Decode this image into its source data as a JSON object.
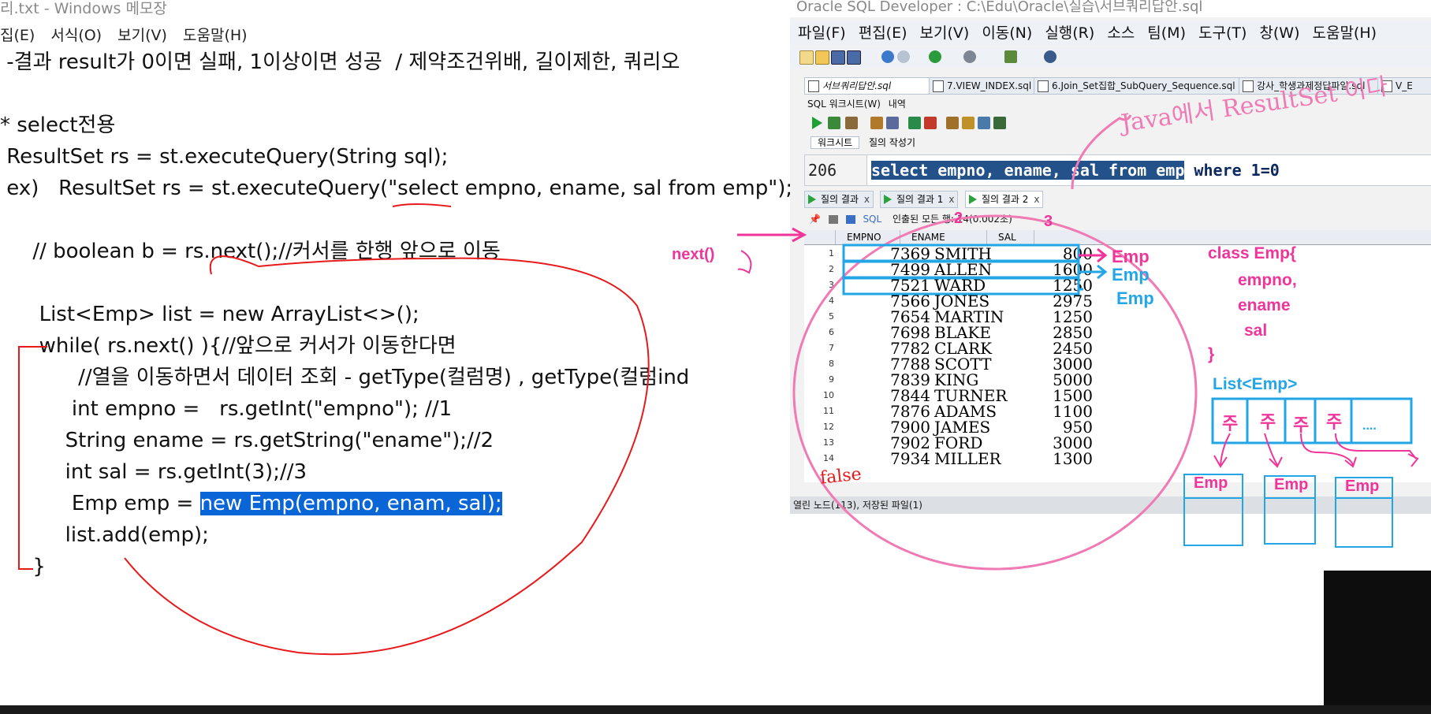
{
  "notepad": {
    "title": "리.txt - Windows 메모장",
    "menu": [
      "집(E)",
      "서식(O)",
      "보기(V)",
      "도움말(H)"
    ],
    "lines": [
      " -결과 result가 0이면 실패, 1이상이면 성공  / 제약조건위배, 길이제한, 쿼리오",
      "",
      "* select전용",
      " ResultSet rs = st.executeQuery(String sql);",
      " ex)   ResultSet rs = st.executeQuery(\"select empno, ename, sal from emp\");",
      "",
      "     // boolean b = rs.next();//커서를 한행 앞으로 이동",
      "",
      "      List<Emp> list = new ArrayList<>();",
      "      while( rs.next() ){//앞으로 커서가 이동한다면",
      "            //열을 이동하면서 데이터 조회 - getType(컬럼명) , getType(컬럼ind",
      "           int empno =   rs.getInt(\"empno\"); //1",
      "          String ename = rs.getString(\"ename\");//2",
      "          int sal = rs.getInt(3);//3",
      "           Emp emp = ",
      "          list.add(emp);",
      "     }"
    ],
    "selected_text": "new Emp(empno, enam, sal);"
  },
  "sqldev": {
    "title": "Oracle SQL Developer : C:\\Edu\\Oracle\\실습\\서브쿼리답안.sql",
    "menu": [
      "파일(F)",
      "편집(E)",
      "보기(V)",
      "이동(N)",
      "실행(R)",
      "소스",
      "팀(M)",
      "도구(T)",
      "창(W)",
      "도움말(H)"
    ],
    "tabs": [
      "서브쿼리답안.sql",
      "7.VIEW_INDEX.sql",
      "6.Join_Set집합_SubQuery_Sequence.sql",
      "강사_학생과제정답파일.sql",
      "V_E"
    ],
    "worksheet_label": "SQL 워크시트(W)",
    "history_label": "내역",
    "ws_tab": "워크시트",
    "query_builder": "질의 작성기",
    "line_no": "206",
    "code_selected": "select empno, ename, sal from emp",
    "code_rest": " where 1=0",
    "result_tabs": [
      "질의 결과",
      "질의 결과 1",
      "질의 결과 2"
    ],
    "result_bar": {
      "sql": "SQL",
      "fetched": "인출된 모든 행: 14(0.002초)"
    },
    "columns": [
      "EMPNO",
      "ENAME",
      "SAL"
    ],
    "rows": [
      [
        "1",
        "7369",
        "SMITH",
        "800"
      ],
      [
        "2",
        "7499",
        "ALLEN",
        "1600"
      ],
      [
        "3",
        "7521",
        "WARD",
        "1250"
      ],
      [
        "4",
        "7566",
        "JONES",
        "2975"
      ],
      [
        "5",
        "7654",
        "MARTIN",
        "1250"
      ],
      [
        "6",
        "7698",
        "BLAKE",
        "2850"
      ],
      [
        "7",
        "7782",
        "CLARK",
        "2450"
      ],
      [
        "8",
        "7788",
        "SCOTT",
        "3000"
      ],
      [
        "9",
        "7839",
        "KING",
        "5000"
      ],
      [
        "10",
        "7844",
        "TURNER",
        "1500"
      ],
      [
        "11",
        "7876",
        "ADAMS",
        "1100"
      ],
      [
        "12",
        "7900",
        "JAMES",
        "950"
      ],
      [
        "13",
        "7902",
        "FORD",
        "3000"
      ],
      [
        "14",
        "7934",
        "MILLER",
        "1300"
      ]
    ],
    "status": "열린 노드(113), 저장된 파일(1)"
  },
  "annotations": {
    "java_resultset": "Java에서 ResultSet 이다",
    "next": "next()",
    "col_num_2": "2",
    "col_num_3": "3",
    "emp_labels": [
      "Emp",
      "Emp",
      "Emp"
    ],
    "class_def": [
      "class Emp{",
      "empno,",
      "ename",
      "sal",
      "}"
    ],
    "list_label": "List<Emp>",
    "list_cells": [
      "주",
      "주",
      "주",
      "주",
      "...."
    ],
    "box_labels": [
      "Emp",
      "Emp",
      "Emp"
    ],
    "false_label": "false",
    "colors": {
      "pink": "#f0359a",
      "cyan": "#22a6e6",
      "red": "#e8191b"
    }
  }
}
